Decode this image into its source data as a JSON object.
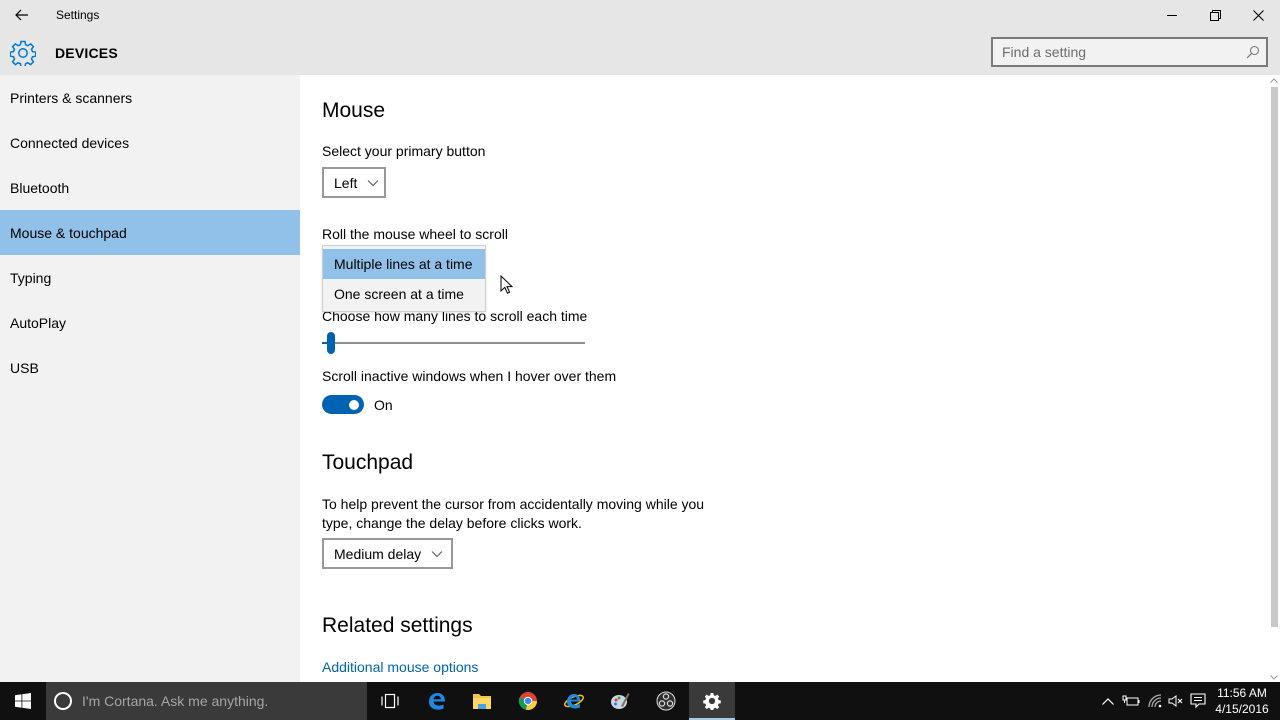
{
  "window": {
    "title": "Settings",
    "back_icon": "back-arrow-icon",
    "minimize_icon": "minimize-icon",
    "maximize_icon": "restore-icon",
    "close_icon": "close-icon"
  },
  "header": {
    "section_icon": "gear-icon",
    "section_title": "DEVICES",
    "search_placeholder": "Find a setting",
    "search_value": ""
  },
  "sidebar": {
    "items": [
      {
        "label": "Printers & scanners",
        "selected": false
      },
      {
        "label": "Connected devices",
        "selected": false
      },
      {
        "label": "Bluetooth",
        "selected": false
      },
      {
        "label": "Mouse & touchpad",
        "selected": true
      },
      {
        "label": "Typing",
        "selected": false
      },
      {
        "label": "AutoPlay",
        "selected": false
      },
      {
        "label": "USB",
        "selected": false
      }
    ]
  },
  "mouse": {
    "heading": "Mouse",
    "primary_button_label": "Select your primary button",
    "primary_button_value": "Left",
    "scroll_label": "Roll the mouse wheel to scroll",
    "scroll_options": [
      {
        "label": "Multiple lines at a time",
        "selected": true
      },
      {
        "label": "One screen at a time",
        "selected": false
      }
    ],
    "lines_label": "Choose how many lines to scroll each time",
    "lines_slider_fraction": 0.02,
    "inactive_scroll_label": "Scroll inactive windows when I hover over them",
    "inactive_scroll_state": "On",
    "inactive_scroll_on": true
  },
  "touchpad": {
    "heading": "Touchpad",
    "description": "To help prevent the cursor from accidentally moving while you type, change the delay before clicks work.",
    "delay_value": "Medium delay"
  },
  "related": {
    "heading": "Related settings",
    "link": "Additional mouse options"
  },
  "taskbar": {
    "cortana_placeholder": "I'm Cortana. Ask me anything.",
    "pinned": [
      {
        "name": "task-view-icon",
        "active": false
      },
      {
        "name": "edge-icon",
        "active": false
      },
      {
        "name": "file-explorer-icon",
        "active": false
      },
      {
        "name": "chrome-icon",
        "active": false
      },
      {
        "name": "internet-explorer-icon",
        "active": false
      },
      {
        "name": "paint-icon",
        "active": false
      },
      {
        "name": "obs-icon",
        "active": false
      },
      {
        "name": "settings-icon",
        "active": true
      }
    ],
    "tray": [
      "show-hidden-icons-chevron",
      "power-icon",
      "wifi-icon",
      "volume-muted-icon",
      "action-center-icon"
    ],
    "time": "11:56 AM",
    "date": "4/15/2016"
  },
  "colors": {
    "accent": "#0063b1",
    "selection": "#91c0e8",
    "sidebar_bg": "#f2f2f2",
    "titlebar_bg": "#e6e6e6",
    "taskbar_bg": "#101010"
  }
}
